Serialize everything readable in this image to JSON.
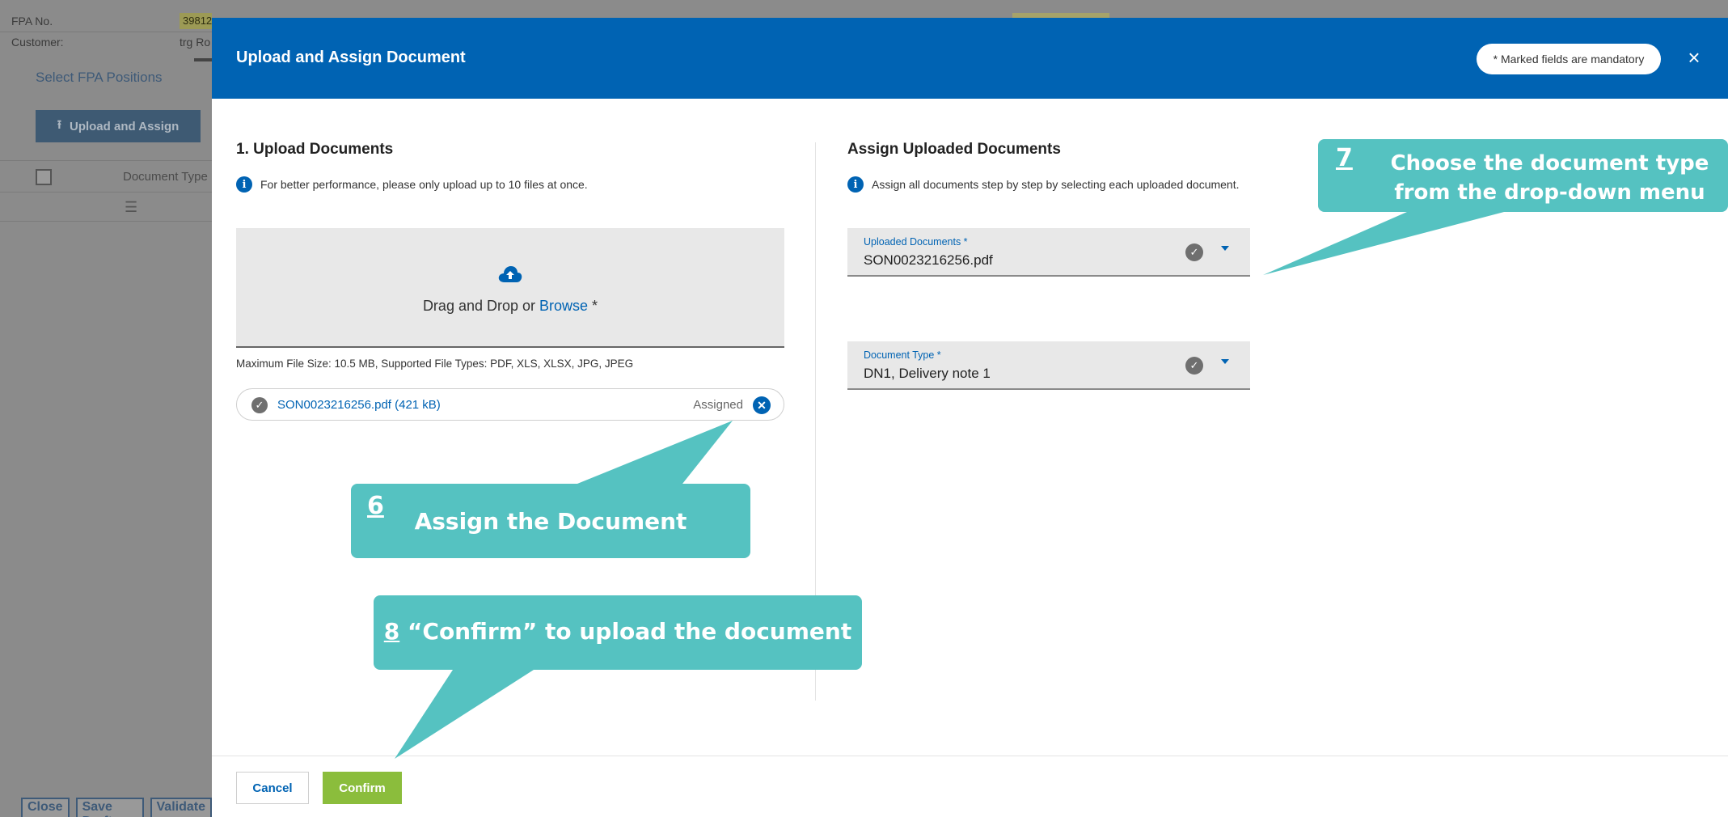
{
  "background": {
    "fpa_label": "FPA No.",
    "fpa_value": "39812",
    "customer_label": "Customer:",
    "customer_value": "trg Ro",
    "tab_select_positions": "Select FPA Positions",
    "upload_assign_button": "Upload and Assign",
    "table_col_document_type": "Document Type",
    "footer_buttons": [
      "Close",
      "Save Draft",
      "Validate"
    ]
  },
  "modal": {
    "title": "Upload and Assign Document",
    "mandatory_note": "* Marked fields are mandatory",
    "close_label": "×",
    "upload": {
      "title": "1. Upload Documents",
      "info": "For better performance, please only upload up to 10 files at once.",
      "drop_text": "Drag and Drop or ",
      "browse_text": "Browse",
      "required_mark": " *",
      "file_hint": "Maximum File Size: 10.5 MB, Supported File Types: PDF, XLS, XLSX, JPG, JPEG",
      "file": {
        "name": "SON0023216256.pdf (421 kB)",
        "status": "Assigned"
      }
    },
    "assign": {
      "title": "Assign Uploaded Documents",
      "info": "Assign all documents step by step by selecting each uploaded document.",
      "uploaded_documents": {
        "label": "Uploaded Documents *",
        "value": "SON0023216256.pdf"
      },
      "document_type": {
        "label": "Document Type *",
        "value": "DN1, Delivery note 1"
      }
    },
    "footer": {
      "cancel": "Cancel",
      "confirm": "Confirm"
    }
  },
  "callouts": {
    "step6": {
      "number": "6",
      "text": "Assign the Document"
    },
    "step7": {
      "number": "7",
      "text": "Choose the document type from the drop-down menu"
    },
    "step8": {
      "number": "8",
      "text": " “Confirm” to upload the document"
    }
  },
  "colors": {
    "header_blue": "#0063b3",
    "callout_teal": "#55c2c1",
    "confirm_green": "#8bbd3c"
  }
}
